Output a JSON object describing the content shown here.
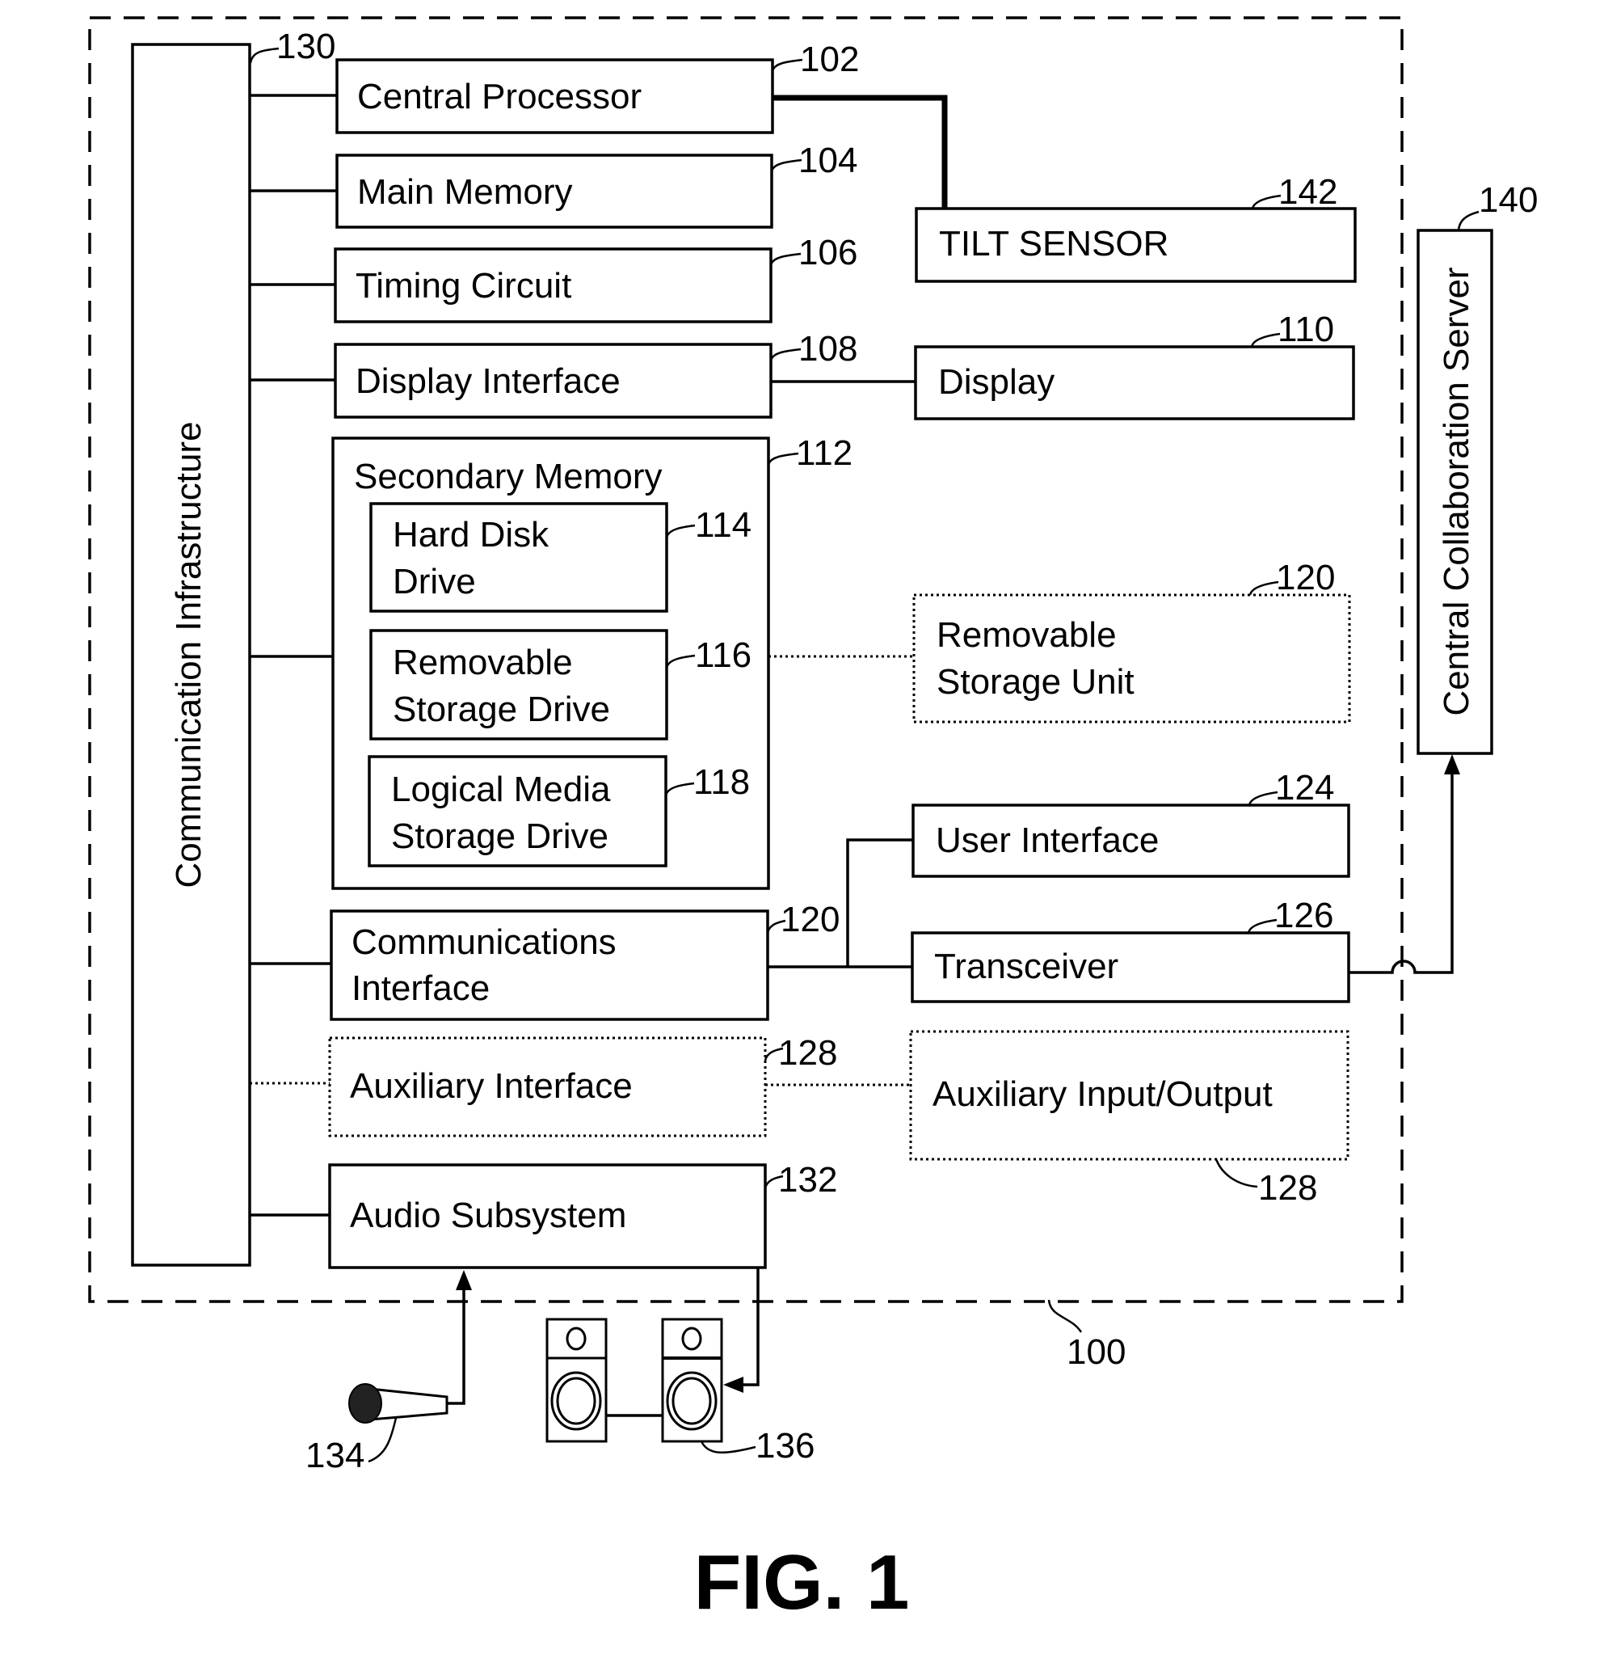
{
  "figure": {
    "caption": "FIG. 1",
    "system_ref": "100"
  },
  "blocks": {
    "comm_infra": {
      "label": "Communication Infrastructure",
      "ref": "130"
    },
    "cpu": {
      "label": "Central Processor",
      "ref": "102"
    },
    "main_memory": {
      "label": "Main Memory",
      "ref": "104"
    },
    "timing": {
      "label": "Timing Circuit",
      "ref": "106"
    },
    "display_if": {
      "label": "Display Interface",
      "ref": "108"
    },
    "secondary_memory": {
      "label": "Secondary Memory",
      "ref": "112"
    },
    "hdd": {
      "line1": "Hard Disk",
      "line2": "Drive",
      "ref": "114"
    },
    "rsd": {
      "line1": "Removable",
      "line2": "Storage Drive",
      "ref": "116"
    },
    "lmsd": {
      "line1": "Logical Media",
      "line2": "Storage Drive",
      "ref": "118"
    },
    "comm_if": {
      "line1": "Communications",
      "line2": "Interface",
      "ref": "120"
    },
    "aux_if": {
      "label": "Auxiliary Interface",
      "ref": "128"
    },
    "audio": {
      "label": "Audio Subsystem",
      "ref": "132"
    },
    "tilt": {
      "label": "TILT SENSOR",
      "ref": "142"
    },
    "display": {
      "label": "Display",
      "ref": "110"
    },
    "rsu": {
      "line1": "Removable",
      "line2": "Storage Unit",
      "ref": "120"
    },
    "user_if": {
      "label": "User Interface",
      "ref": "124"
    },
    "transceiver": {
      "label": "Transceiver",
      "ref": "126"
    },
    "aux_io": {
      "label": "Auxiliary Input/Output",
      "ref": "128"
    },
    "server": {
      "label": "Central Collaboration Server",
      "ref": "140"
    },
    "microphone": {
      "ref": "134"
    },
    "speakers": {
      "ref": "136"
    }
  }
}
